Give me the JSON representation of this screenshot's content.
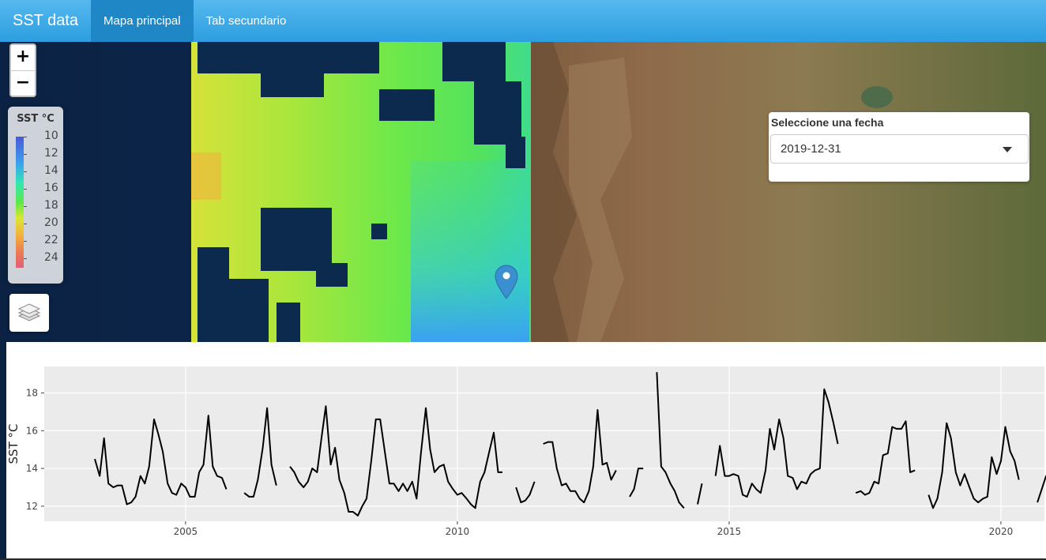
{
  "navbar": {
    "brand": "SST data",
    "tabs": [
      {
        "label": "Mapa principal",
        "active": true
      },
      {
        "label": "Tab secundario",
        "active": false
      }
    ],
    "color": "#3aa8e8"
  },
  "map": {
    "zoom_in": "+",
    "zoom_out": "−",
    "legend": {
      "title": "SST °C",
      "ticks": [
        "10",
        "12",
        "14",
        "16",
        "18",
        "20",
        "22",
        "24"
      ]
    },
    "layers_icon": "layers-icon",
    "marker_icon": "map-pin-icon"
  },
  "date_selector": {
    "label": "Seleccione una fecha",
    "value": "2019-12-31"
  },
  "chart_data": {
    "type": "line",
    "title": "",
    "xlabel": "",
    "ylabel": "SST °C",
    "xlim": [
      2002.4,
      2020.8
    ],
    "ylim": [
      11.2,
      19.4
    ],
    "xticks": [
      2005,
      2010,
      2015,
      2020
    ],
    "yticks": [
      12,
      14,
      16,
      18
    ],
    "grid": true,
    "line_color": "#000000",
    "panel_color": "#ebebeb",
    "segments": [
      [
        [
          2003.33,
          14.5
        ],
        [
          2003.42,
          13.6
        ],
        [
          2003.5,
          15.6
        ],
        [
          2003.58,
          13.2
        ],
        [
          2003.67,
          13.0
        ],
        [
          2003.75,
          13.1
        ],
        [
          2003.83,
          13.1
        ],
        [
          2003.92,
          12.1
        ],
        [
          2004.0,
          12.2
        ],
        [
          2004.08,
          12.5
        ],
        [
          2004.17,
          13.6
        ],
        [
          2004.25,
          13.2
        ],
        [
          2004.33,
          14.1
        ],
        [
          2004.42,
          16.6
        ],
        [
          2004.5,
          15.8
        ],
        [
          2004.58,
          14.9
        ],
        [
          2004.67,
          13.2
        ],
        [
          2004.75,
          12.7
        ],
        [
          2004.83,
          12.6
        ],
        [
          2004.92,
          13.2
        ],
        [
          2005.0,
          13.0
        ],
        [
          2005.08,
          12.5
        ],
        [
          2005.17,
          12.5
        ],
        [
          2005.25,
          13.8
        ],
        [
          2005.33,
          14.2
        ],
        [
          2005.42,
          16.8
        ],
        [
          2005.5,
          14.1
        ],
        [
          2005.58,
          13.6
        ],
        [
          2005.67,
          13.5
        ],
        [
          2005.75,
          12.9
        ]
      ],
      [
        [
          2006.08,
          12.7
        ],
        [
          2006.17,
          12.5
        ],
        [
          2006.25,
          12.5
        ],
        [
          2006.33,
          13.4
        ],
        [
          2006.42,
          15.1
        ],
        [
          2006.5,
          17.2
        ],
        [
          2006.58,
          14.2
        ],
        [
          2006.67,
          13.1
        ]
      ],
      [
        [
          2006.92,
          14.1
        ],
        [
          2007.0,
          13.8
        ],
        [
          2007.08,
          13.3
        ],
        [
          2007.17,
          13.0
        ],
        [
          2007.25,
          13.3
        ],
        [
          2007.33,
          14.0
        ],
        [
          2007.42,
          13.8
        ],
        [
          2007.5,
          15.6
        ],
        [
          2007.58,
          17.3
        ],
        [
          2007.67,
          14.2
        ],
        [
          2007.75,
          15.1
        ],
        [
          2007.83,
          13.4
        ],
        [
          2007.92,
          12.7
        ],
        [
          2008.0,
          11.7
        ],
        [
          2008.08,
          11.7
        ],
        [
          2008.17,
          11.5
        ],
        [
          2008.25,
          12.0
        ],
        [
          2008.33,
          12.4
        ],
        [
          2008.42,
          14.5
        ],
        [
          2008.5,
          16.6
        ],
        [
          2008.58,
          16.6
        ],
        [
          2008.67,
          14.8
        ],
        [
          2008.75,
          13.2
        ],
        [
          2008.83,
          13.2
        ],
        [
          2008.92,
          12.8
        ],
        [
          2009.0,
          13.2
        ],
        [
          2009.08,
          12.8
        ],
        [
          2009.17,
          13.3
        ],
        [
          2009.25,
          12.4
        ],
        [
          2009.33,
          14.8
        ],
        [
          2009.42,
          17.2
        ],
        [
          2009.5,
          15.0
        ],
        [
          2009.58,
          13.8
        ],
        [
          2009.67,
          14.1
        ],
        [
          2009.75,
          14.2
        ],
        [
          2009.83,
          13.3
        ],
        [
          2009.92,
          12.9
        ],
        [
          2010.0,
          12.6
        ],
        [
          2010.08,
          12.7
        ],
        [
          2010.17,
          12.4
        ],
        [
          2010.25,
          12.1
        ],
        [
          2010.33,
          11.9
        ],
        [
          2010.42,
          13.3
        ],
        [
          2010.5,
          13.8
        ],
        [
          2010.58,
          14.8
        ],
        [
          2010.67,
          15.9
        ],
        [
          2010.75,
          13.8
        ],
        [
          2010.83,
          13.8
        ]
      ],
      [
        [
          2011.08,
          13.0
        ],
        [
          2011.17,
          12.2
        ],
        [
          2011.25,
          12.3
        ],
        [
          2011.33,
          12.6
        ],
        [
          2011.42,
          13.3
        ]
      ],
      [
        [
          2011.58,
          15.3
        ],
        [
          2011.67,
          15.4
        ],
        [
          2011.75,
          15.4
        ],
        [
          2011.83,
          14.0
        ],
        [
          2011.92,
          13.1
        ],
        [
          2012.0,
          13.2
        ],
        [
          2012.08,
          12.8
        ],
        [
          2012.17,
          12.8
        ],
        [
          2012.25,
          12.4
        ],
        [
          2012.33,
          12.2
        ],
        [
          2012.42,
          12.8
        ],
        [
          2012.5,
          14.1
        ],
        [
          2012.58,
          17.1
        ],
        [
          2012.67,
          14.2
        ],
        [
          2012.75,
          14.3
        ],
        [
          2012.83,
          13.4
        ],
        [
          2012.92,
          13.9
        ]
      ],
      [
        [
          2013.17,
          12.5
        ],
        [
          2013.25,
          12.9
        ],
        [
          2013.33,
          14.0
        ],
        [
          2013.42,
          14.0
        ]
      ],
      [
        [
          2013.67,
          19.1
        ],
        [
          2013.75,
          14.1
        ],
        [
          2013.83,
          13.8
        ],
        [
          2013.92,
          13.2
        ],
        [
          2014.0,
          12.8
        ],
        [
          2014.08,
          12.2
        ],
        [
          2014.17,
          11.9
        ]
      ],
      [
        [
          2014.42,
          12.1
        ],
        [
          2014.5,
          13.2
        ]
      ],
      [
        [
          2014.75,
          13.6
        ],
        [
          2014.83,
          15.2
        ],
        [
          2014.92,
          13.6
        ],
        [
          2015.0,
          13.6
        ],
        [
          2015.08,
          13.7
        ],
        [
          2015.17,
          13.6
        ],
        [
          2015.25,
          12.6
        ],
        [
          2015.33,
          12.5
        ],
        [
          2015.42,
          13.2
        ],
        [
          2015.5,
          12.9
        ],
        [
          2015.58,
          12.7
        ],
        [
          2015.67,
          13.9
        ],
        [
          2015.75,
          16.1
        ],
        [
          2015.83,
          15.0
        ],
        [
          2015.92,
          16.6
        ],
        [
          2016.0,
          15.6
        ],
        [
          2016.08,
          13.6
        ],
        [
          2016.17,
          13.5
        ],
        [
          2016.25,
          12.9
        ],
        [
          2016.33,
          13.3
        ],
        [
          2016.42,
          13.2
        ],
        [
          2016.5,
          13.7
        ],
        [
          2016.58,
          13.9
        ],
        [
          2016.67,
          14.0
        ],
        [
          2016.75,
          18.2
        ],
        [
          2016.83,
          17.5
        ],
        [
          2016.92,
          16.4
        ],
        [
          2017.0,
          15.3
        ]
      ],
      [
        [
          2017.33,
          12.7
        ],
        [
          2017.42,
          12.8
        ],
        [
          2017.5,
          12.6
        ],
        [
          2017.58,
          12.7
        ],
        [
          2017.67,
          13.3
        ],
        [
          2017.75,
          13.2
        ],
        [
          2017.83,
          14.7
        ],
        [
          2017.92,
          14.8
        ],
        [
          2018.0,
          16.2
        ],
        [
          2018.08,
          16.1
        ],
        [
          2018.17,
          16.1
        ],
        [
          2018.25,
          16.5
        ],
        [
          2018.33,
          13.8
        ],
        [
          2018.42,
          13.9
        ]
      ],
      [
        [
          2018.67,
          12.6
        ],
        [
          2018.75,
          11.9
        ],
        [
          2018.83,
          12.4
        ],
        [
          2018.92,
          13.8
        ],
        [
          2019.0,
          16.4
        ],
        [
          2019.08,
          15.6
        ],
        [
          2019.17,
          13.8
        ],
        [
          2019.25,
          13.1
        ],
        [
          2019.33,
          13.7
        ],
        [
          2019.42,
          13.0
        ],
        [
          2019.5,
          12.4
        ],
        [
          2019.58,
          12.2
        ],
        [
          2019.67,
          12.4
        ],
        [
          2019.75,
          12.5
        ],
        [
          2019.83,
          14.6
        ],
        [
          2019.92,
          13.7
        ],
        [
          2020.0,
          14.4
        ],
        [
          2020.08,
          16.2
        ],
        [
          2020.17,
          14.9
        ],
        [
          2020.25,
          14.4
        ],
        [
          2020.33,
          13.4
        ]
      ],
      [
        [
          2020.67,
          12.2
        ],
        [
          2020.75,
          12.9
        ],
        [
          2020.83,
          13.6
        ],
        [
          2020.92,
          13.1
        ]
      ]
    ]
  }
}
